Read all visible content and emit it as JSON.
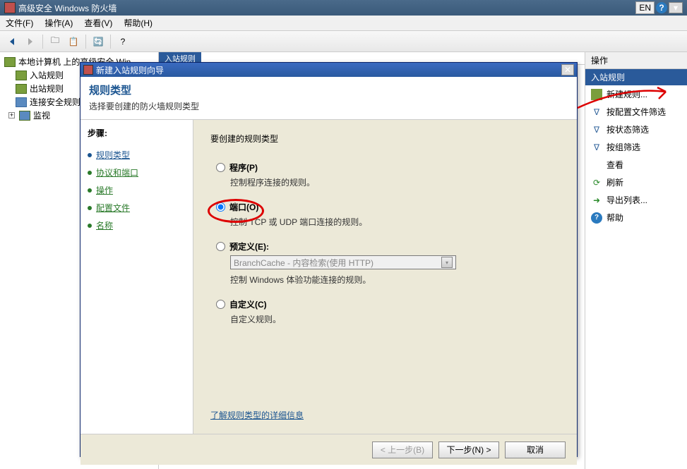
{
  "window": {
    "title": "高级安全 Windows 防火墙",
    "lang": "EN"
  },
  "menu": {
    "file": "文件(F)",
    "action": "操作(A)",
    "view": "查看(V)",
    "help": "帮助(H)"
  },
  "tree": {
    "root": "本地计算机 上的高级安全 Win",
    "inbound": "入站规则",
    "outbound": "出站规则",
    "connsec": "连接安全规则",
    "monitor": "监视"
  },
  "center_tab": "入站规则",
  "actions": {
    "header": "操作",
    "section": "入站规则",
    "new_rule": "新建规则...",
    "filter_profile": "按配置文件筛选",
    "filter_state": "按状态筛选",
    "filter_group": "按组筛选",
    "view": "查看",
    "refresh": "刷新",
    "export": "导出列表...",
    "help": "帮助"
  },
  "wizard": {
    "title": "新建入站规则向导",
    "heading": "规则类型",
    "subheading": "选择要创建的防火墙规则类型",
    "steps_label": "步骤:",
    "steps": {
      "rule_type": "规则类型",
      "protocol": "协议和端口",
      "action": "操作",
      "profile": "配置文件",
      "name": "名称"
    },
    "content": {
      "prompt": "要创建的规则类型",
      "program": {
        "label": "程序(P)",
        "desc": "控制程序连接的规则。"
      },
      "port": {
        "label": "端口(O)",
        "desc": "控制 TCP 或 UDP 端口连接的规则。"
      },
      "predefined": {
        "label": "预定义(E):",
        "desc": "控制 Windows 体验功能连接的规则。",
        "combo": "BranchCache - 内容检索(使用 HTTP)"
      },
      "custom": {
        "label": "自定义(C)",
        "desc": "自定义规则。"
      },
      "learn_more": "了解规则类型的详细信息"
    },
    "buttons": {
      "back": "< 上一步(B)",
      "next": "下一步(N) >",
      "cancel": "取消"
    }
  }
}
